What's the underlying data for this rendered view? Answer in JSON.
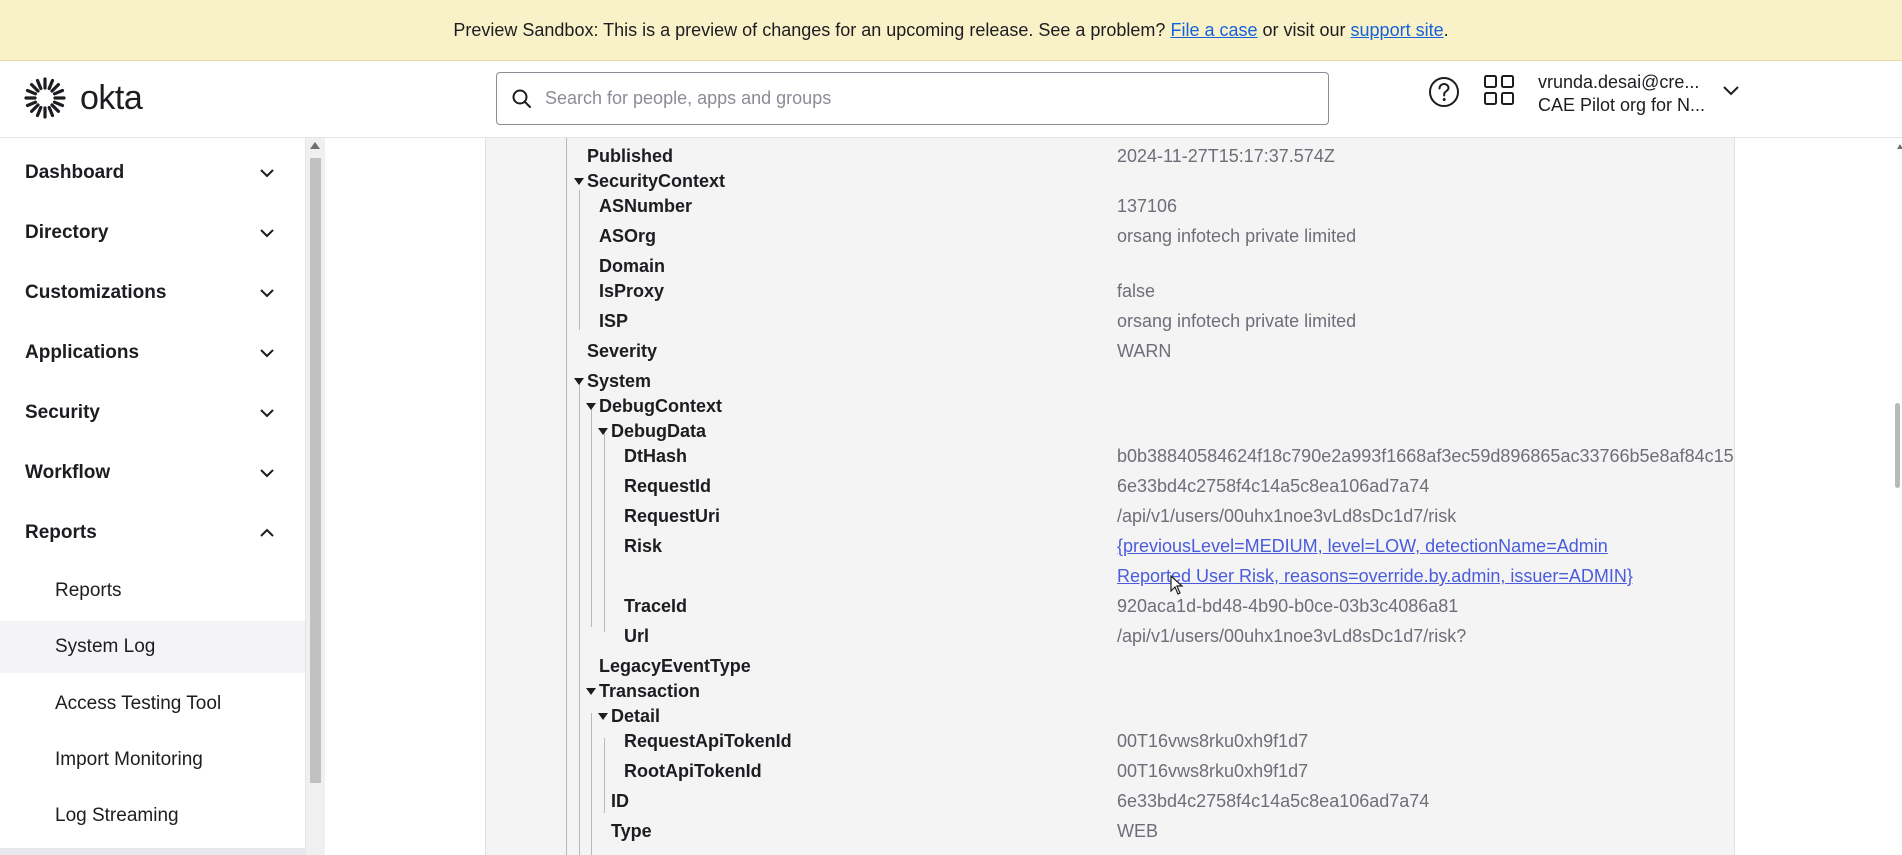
{
  "banner": {
    "text_before": "Preview Sandbox: This is a preview of changes for an upcoming release. See a problem? ",
    "link_file_case": "File a case",
    "text_middle": " or visit our ",
    "link_support": "support site",
    "text_after": "."
  },
  "header": {
    "logo_text": "okta",
    "search_placeholder": "Search for people, apps and groups",
    "user_email": "vrunda.desai@cre...",
    "user_org": "CAE Pilot org for N..."
  },
  "sidebar": {
    "items": [
      {
        "label": "Dashboard"
      },
      {
        "label": "Directory"
      },
      {
        "label": "Customizations"
      },
      {
        "label": "Applications"
      },
      {
        "label": "Security"
      },
      {
        "label": "Workflow"
      },
      {
        "label": "Reports"
      }
    ],
    "reports_sub": [
      {
        "label": "Reports"
      },
      {
        "label": "System Log"
      },
      {
        "label": "Access Testing Tool"
      },
      {
        "label": "Import Monitoring"
      },
      {
        "label": "Log Streaming"
      }
    ]
  },
  "log": {
    "published_key": "Published",
    "published_val": "2024-11-27T15:17:37.574Z",
    "security_context_key": "SecurityContext",
    "asnumber_key": "ASNumber",
    "asnumber_val": "137106",
    "asorg_key": "ASOrg",
    "asorg_val": "orsang infotech private limited",
    "domain_key": "Domain",
    "isproxy_key": "IsProxy",
    "isproxy_val": "false",
    "isp_key": "ISP",
    "isp_val": "orsang infotech private limited",
    "severity_key": "Severity",
    "severity_val": "WARN",
    "system_key": "System",
    "debug_context_key": "DebugContext",
    "debug_data_key": "DebugData",
    "dthash_key": "DtHash",
    "dthash_val": "b0b38840584624f18c790e2a993f1668af3ec59d896865ac33766b5e8af84c15",
    "requestid_key": "RequestId",
    "requestid_val": "6e33bd4c2758f4c14a5c8ea106ad7a74",
    "requesturi_key": "RequestUri",
    "requesturi_val": "/api/v1/users/00uhx1noe3vLd8sDc1d7/risk",
    "risk_key": "Risk",
    "risk_val_line1": "{previousLevel=MEDIUM, level=LOW, detectionName=Admin",
    "risk_val_line2": "Reported User Risk, reasons=override.by.admin, issuer=ADMIN}",
    "traceid_key": "TraceId",
    "traceid_val": "920aca1d-bd48-4b90-b0ce-03b3c4086a81",
    "url_key": "Url",
    "url_val": "/api/v1/users/00uhx1noe3vLd8sDc1d7/risk?",
    "legacy_key": "LegacyEventType",
    "transaction_key": "Transaction",
    "detail_key": "Detail",
    "req_api_token_key": "RequestApiTokenId",
    "req_api_token_val": "00T16vws8rku0xh9f1d7",
    "root_api_token_key": "RootApiTokenId",
    "root_api_token_val": "00T16vws8rku0xh9f1d7",
    "id_key": "ID",
    "id_val": "6e33bd4c2758f4c14a5c8ea106ad7a74",
    "type_key": "Type",
    "type_val": "WEB"
  }
}
